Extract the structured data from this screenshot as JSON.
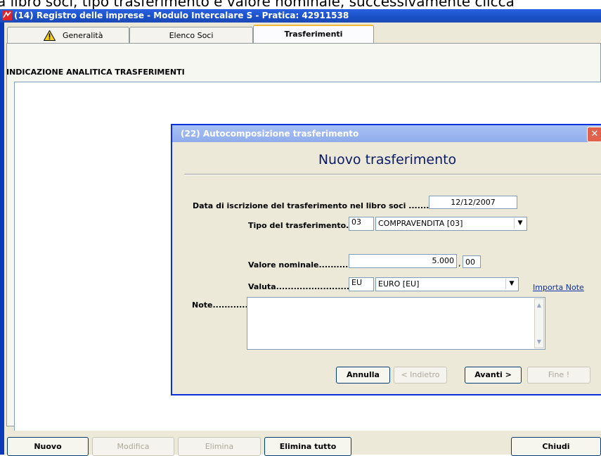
{
  "caption": "a libro soci, tipo trasferimento e valore nominale, successivamente clicca",
  "window": {
    "title": "(14) Registro delle imprese - Modulo Intercalare S - Pratica: 42911538"
  },
  "tabs": [
    {
      "label": "Generalità"
    },
    {
      "label": "Elenco Soci"
    },
    {
      "label": "Trasferimenti"
    }
  ],
  "section_title": "INDICAZIONE ANALITICA TRASFERIMENTI",
  "dialog": {
    "title": "(22) Autocomposizione trasferimento",
    "heading": "Nuovo trasferimento",
    "data_label": "Data di iscrizione del trasferimento nel libro soci ...........",
    "data_value": "12/12/2007",
    "tipo_label": "Tipo del trasferimento....",
    "tipo_code": "03",
    "tipo_value": "COMPRAVENDITA [03]",
    "valore_label": "Valore nominale.................",
    "valore_int": "5.000",
    "valore_comma": ",",
    "valore_dec": "00",
    "valuta_label": "Valuta.................................",
    "valuta_code": "EU",
    "valuta_value": "EURO [EU]",
    "importa_note": "Importa Note",
    "note_label": "Note...............",
    "buttons": {
      "annulla": "Annulla",
      "indietro": "< Indietro",
      "avanti": "Avanti >",
      "fine": "Fine !"
    }
  },
  "bottom_buttons": {
    "nuovo": "Nuovo",
    "modifica": "Modifica",
    "elimina": "Elimina",
    "elimina_tutto": "Elimina tutto",
    "chiudi": "Chiudi"
  },
  "colors": {
    "titlebar": "#1a4fc5",
    "dialog_title": "#90acec",
    "close": "#e0614c",
    "link": "#0b2fa6"
  }
}
